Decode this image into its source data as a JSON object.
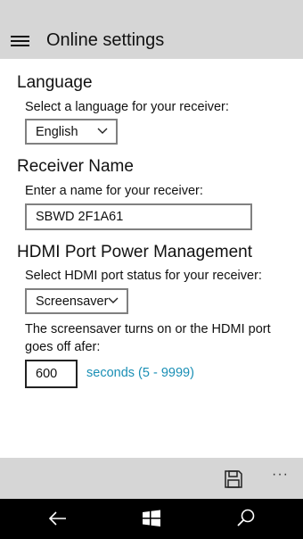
{
  "header": {
    "menu_icon": "hamburger-menu-icon",
    "title": "Online settings"
  },
  "language": {
    "heading": "Language",
    "label": "Select a language for your receiver:",
    "selected": "English"
  },
  "receiver_name": {
    "heading": "Receiver Name",
    "label": "Enter a name for your receiver:",
    "value": "SBWD 2F1A61"
  },
  "hdmi": {
    "heading": "HDMI Port Power Management",
    "label": "Select HDMI port status for your receiver:",
    "selected": "Screensaver",
    "description_line1": "The screensaver turns on or the HDMI port",
    "description_line2": "goes off afer:",
    "timeout_value": "600",
    "range_text": "seconds (5 - 9999)"
  },
  "app_bar": {
    "save_icon": "save-icon",
    "more_label": "···"
  },
  "nav_bar": {
    "icons": [
      "back-arrow-icon",
      "windows-logo-icon",
      "search-icon"
    ]
  },
  "colors": {
    "header_bg": "#d6d6d6",
    "accent": "#1a8fb5",
    "navbar_bg": "#000000"
  }
}
